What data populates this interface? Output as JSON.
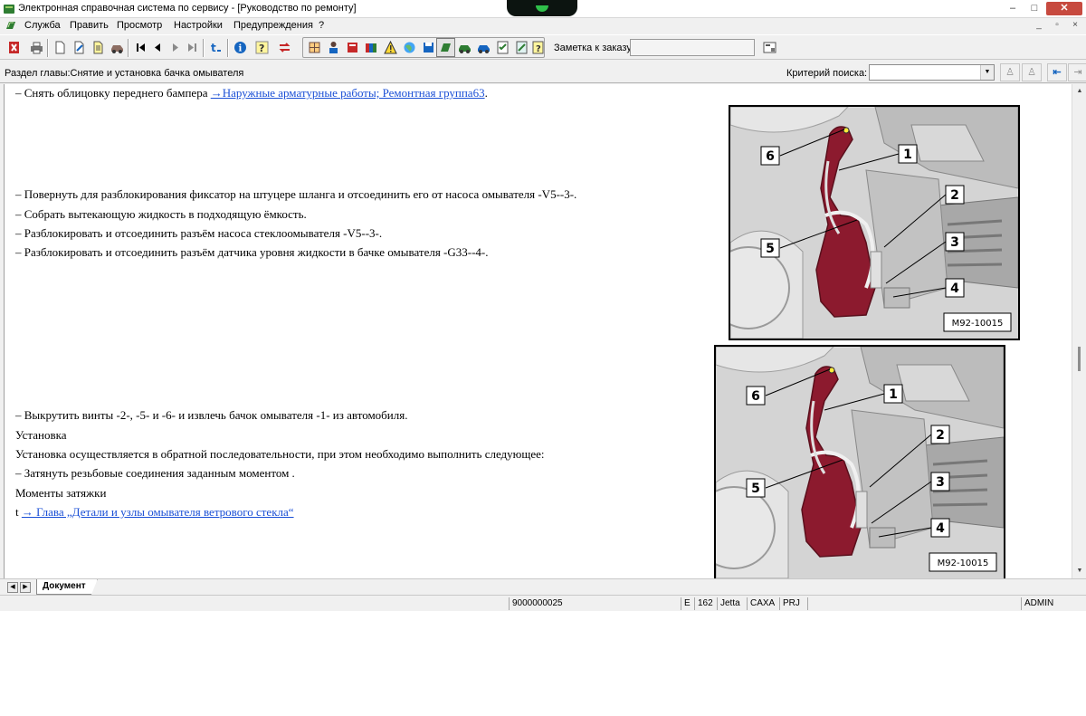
{
  "window": {
    "title": "Электронная справочная система по сервису - [Руководство по ремонту]",
    "controls": [
      "–",
      "□",
      "✕"
    ]
  },
  "menu": {
    "items": [
      "Служба",
      "Править",
      "Просмотр",
      "Настройки",
      "Предупреждения",
      "?"
    ],
    "mdi_controls": [
      "_",
      "▫",
      "×"
    ]
  },
  "toolbar": {
    "order_note_label": "Заметка к заказу:",
    "order_note_value": ""
  },
  "section": {
    "title": "Раздел главы:Снятие и установка бачка омывателя",
    "criteria_label": "Критерий  поиска:",
    "criteria_value": ""
  },
  "content": {
    "line1_prefix": "–  Снять облицовку переднего бампера ",
    "line1_link": "→Наружные арматурные работы; Ремонтная группа63",
    "line1_suffix": ".",
    "line2": "–  Повернуть для разблокирования фиксатор на штуцере шланга и отсоединить его от насоса омывателя -V5--3-.",
    "line3": "–  Собрать вытекающую жидкость в подходящую ёмкость.",
    "line4": "–  Разблокировать и отсоединить разъём насоса стеклоомывателя -V5--3-.",
    "line5": "–  Разблокировать и отсоединить разъём датчика уровня жидкости в бачке омывателя -G33--4-.",
    "line6": "–  Выкрутить винты -2-, -5- и -6- и извлечь бачок омывателя -1- из автомобиля.",
    "line7": "Установка",
    "line8": "Установка осуществляется в обратной последовательности, при этом необходимо выполнить следующее:",
    "line9": "–  Затянуть резьбовые соединения заданным моментом .",
    "line10": "Моменты затяжки",
    "line11_prefix": "t  ",
    "line11_link": "→ Глава „Детали и узлы омывателя ветрового стекла“"
  },
  "figures": [
    {
      "code": "M92-10015",
      "callouts": [
        "6",
        "1",
        "2",
        "5",
        "3",
        "4"
      ]
    },
    {
      "code": "M92-10015",
      "callouts": [
        "6",
        "1",
        "2",
        "5",
        "3",
        "4"
      ]
    }
  ],
  "tabs": {
    "nav_prev": "◀",
    "nav_next": "▶",
    "document_tab": "Документ"
  },
  "status": {
    "number": "9000000025",
    "lang": "E",
    "group": "162",
    "model": "Jetta",
    "code": "CAXA",
    "type": "PRJ",
    "user": "ADMIN"
  },
  "colors": {
    "link": "#1a4fd6",
    "reservoir": "#8c1a2e",
    "close_button": "#c74a3f"
  }
}
